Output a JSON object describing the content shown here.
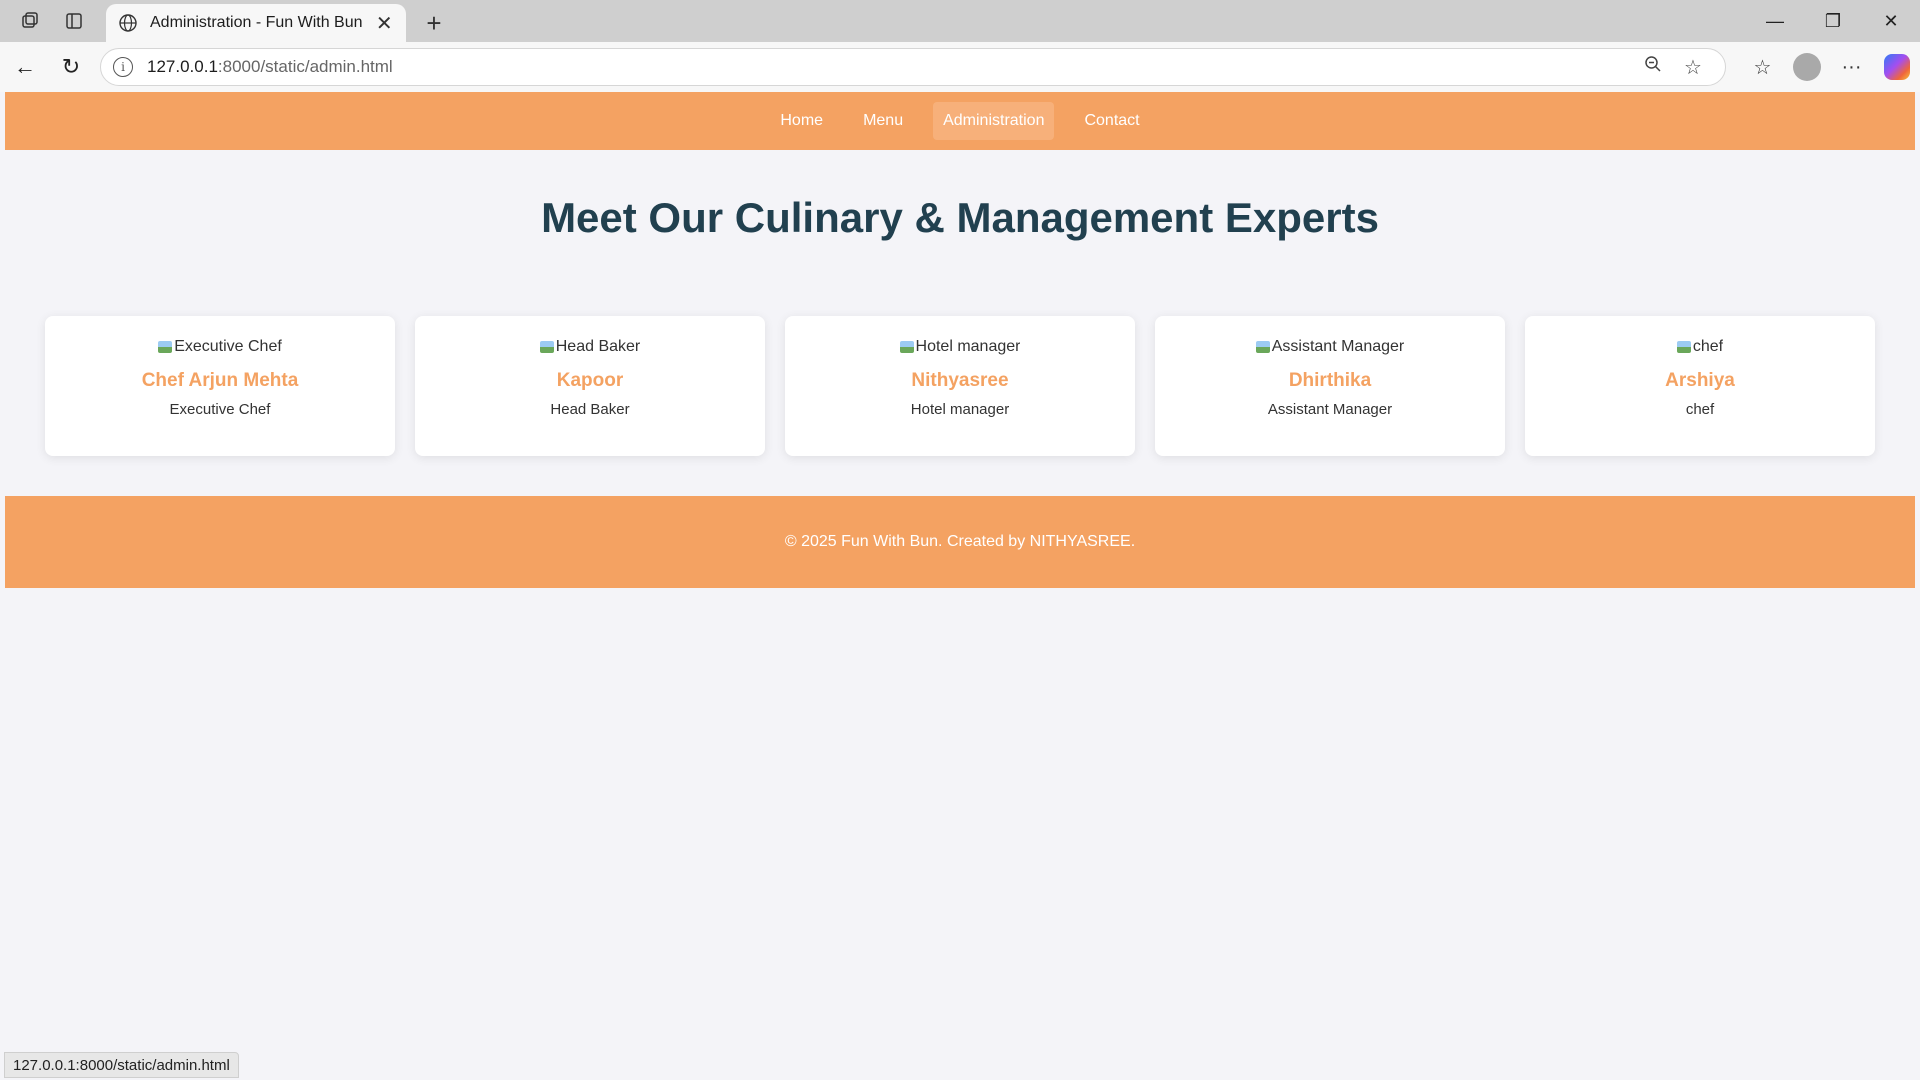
{
  "browser": {
    "tab_title": "Administration - Fun With Bun",
    "url_host": "127.0.0.1",
    "url_path": ":8000/static/admin.html",
    "status_url": "127.0.0.1:8000/static/admin.html"
  },
  "nav": {
    "items": [
      {
        "label": "Home"
      },
      {
        "label": "Menu"
      },
      {
        "label": "Administration",
        "active": true
      },
      {
        "label": "Contact"
      }
    ]
  },
  "heading": "Meet Our Culinary & Management Experts",
  "team": [
    {
      "img_alt": "Executive Chef",
      "name": "Chef Arjun Mehta",
      "role": "Executive Chef"
    },
    {
      "img_alt": "Head Baker",
      "name": "Kapoor",
      "role": "Head Baker"
    },
    {
      "img_alt": "Hotel manager",
      "name": "Nithyasree",
      "role": "Hotel manager"
    },
    {
      "img_alt": "Assistant Manager",
      "name": "Dhirthika",
      "role": "Assistant Manager"
    },
    {
      "img_alt": "chef",
      "name": "Arshiya",
      "role": "chef"
    }
  ],
  "footer": "© 2025 Fun With Bun. Created by NITHYASREE.",
  "colors": {
    "accent": "#f4a262",
    "heading": "#21404f",
    "background": "#f4f4f8"
  },
  "icons": [
    "workspaces-icon",
    "tab-actions-icon",
    "globe-icon",
    "close-icon",
    "new-tab-icon",
    "minimize-icon",
    "restore-icon",
    "window-close-icon",
    "back-icon",
    "reload-icon",
    "info-icon",
    "zoom-icon",
    "favorite-star-icon",
    "favorites-icon",
    "profile-icon",
    "more-icon",
    "copilot-icon"
  ]
}
